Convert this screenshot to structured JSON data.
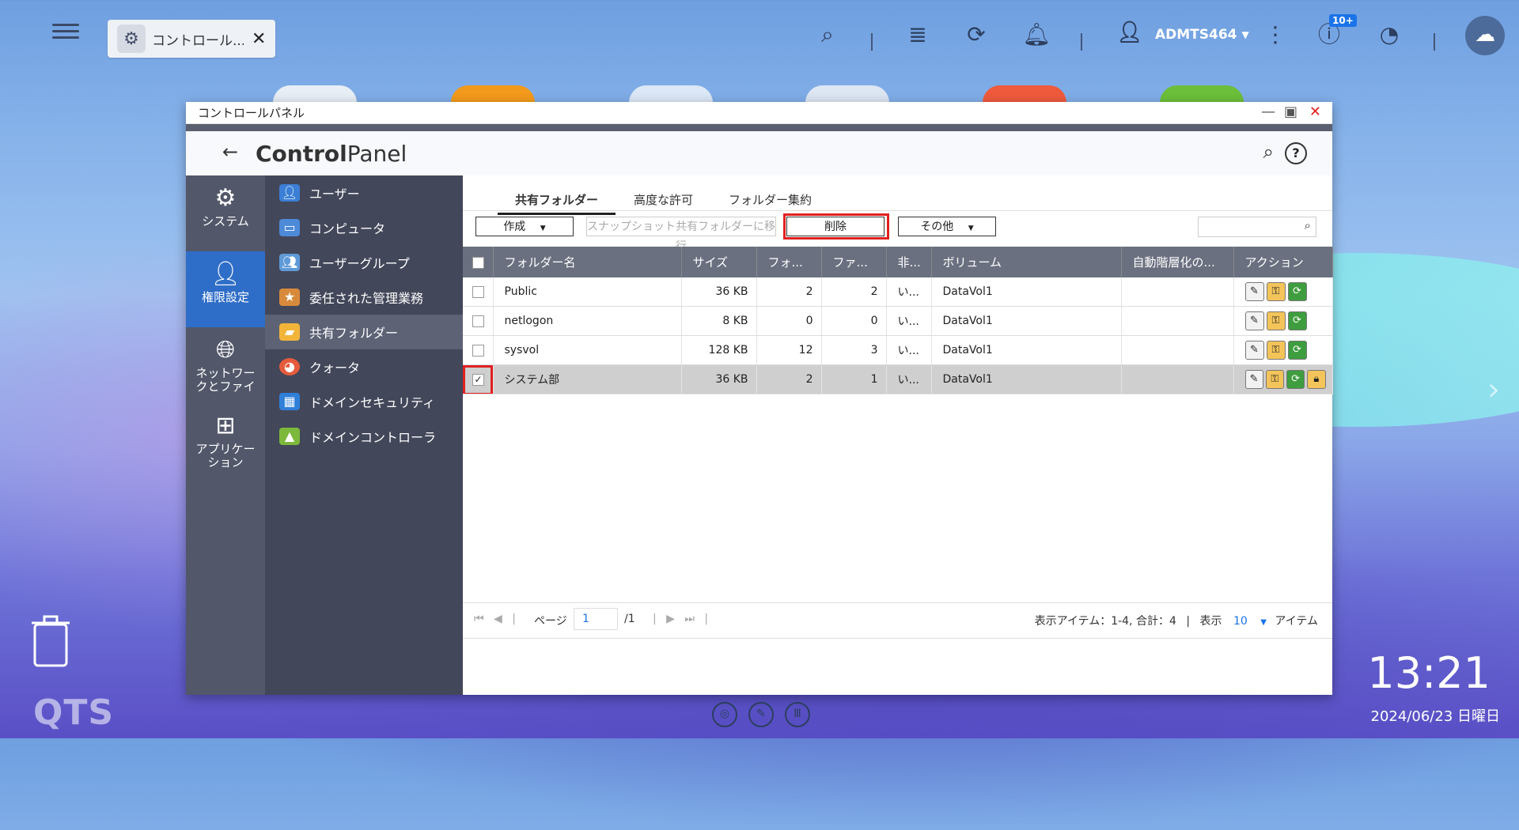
{
  "desktop": {
    "logo": "QTS",
    "clock": "13:21",
    "date": "2024/06/23 日曜日"
  },
  "topbar": {
    "tab_label": "コントロール...",
    "user": "ADMTS464",
    "notif_badge": "10+"
  },
  "window": {
    "title": "コントロールパネル",
    "header_bold": "Control",
    "header_light": "Panel"
  },
  "categories": [
    {
      "label": "システム",
      "icon": "gear-icon"
    },
    {
      "label": "権限設定",
      "icon": "user-icon"
    },
    {
      "label": "ネットワークとファイ",
      "icon": "globe-icon"
    },
    {
      "label": "アプリケーション",
      "icon": "apps-icon"
    }
  ],
  "nav": [
    {
      "label": "ユーザー"
    },
    {
      "label": "コンピュータ"
    },
    {
      "label": "ユーザーグループ"
    },
    {
      "label": "委任された管理業務"
    },
    {
      "label": "共有フォルダー"
    },
    {
      "label": "クォータ"
    },
    {
      "label": "ドメインセキュリティ"
    },
    {
      "label": "ドメインコントローラ"
    }
  ],
  "tabs": [
    "共有フォルダー",
    "高度な許可",
    "フォルダー集約"
  ],
  "toolbar": {
    "create": "作成",
    "snapshot": "スナップショット共有フォルダーに移行",
    "delete": "削除",
    "other": "その他"
  },
  "table": {
    "headers": [
      "フォルダー名",
      "サイズ",
      "フォ...",
      "ファ...",
      "非...",
      "ボリューム",
      "自動階層化の...",
      "アクション"
    ],
    "rows": [
      {
        "name": "Public",
        "size": "36 KB",
        "folders": "2",
        "files": "2",
        "hidden": "い...",
        "volume": "DataVol1",
        "checked": false
      },
      {
        "name": "netlogon",
        "size": "8 KB",
        "folders": "0",
        "files": "0",
        "hidden": "い...",
        "volume": "DataVol1",
        "checked": false
      },
      {
        "name": "sysvol",
        "size": "128 KB",
        "folders": "12",
        "files": "3",
        "hidden": "い...",
        "volume": "DataVol1",
        "checked": false
      },
      {
        "name": "システム部",
        "size": "36 KB",
        "folders": "2",
        "files": "1",
        "hidden": "い...",
        "volume": "DataVol1",
        "checked": true
      }
    ]
  },
  "pager": {
    "page_label": "ページ",
    "page": "1",
    "total": "/1",
    "info": "表示アイテム：1-4, 合計：4",
    "show": "表示",
    "per_page": "10",
    "items": "アイテム"
  },
  "colors": {
    "accent": "#2f6ec8",
    "highlight": "#e02020"
  }
}
